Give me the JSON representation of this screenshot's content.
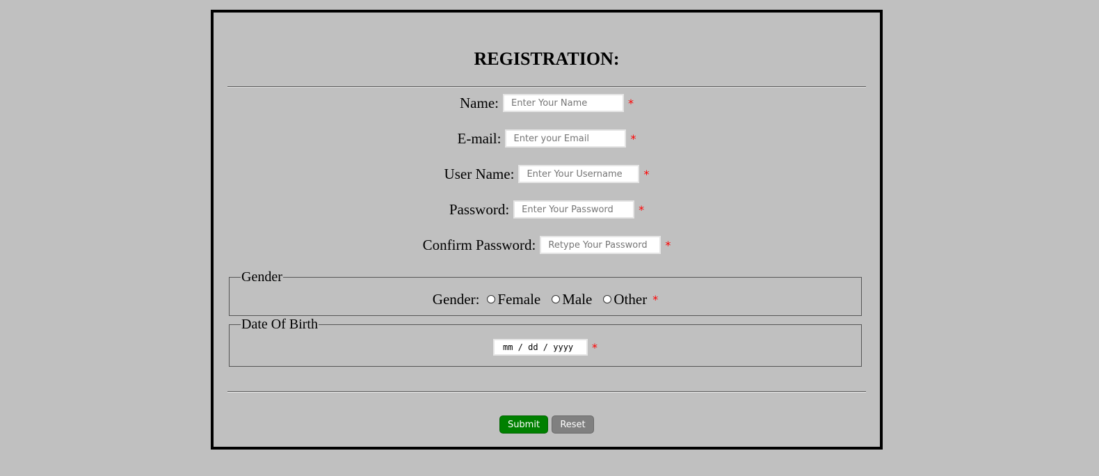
{
  "form": {
    "title": "REGISTRATION:",
    "required_mark": "*",
    "fields": {
      "name": {
        "label": "Name:",
        "placeholder": "Enter Your Name"
      },
      "email": {
        "label": "E-mail:",
        "placeholder": "Enter your Email"
      },
      "username": {
        "label": "User Name:",
        "placeholder": "Enter Your Username"
      },
      "password": {
        "label": "Password:",
        "placeholder": "Enter Your Password"
      },
      "confirm_password": {
        "label": "Confirm Password:",
        "placeholder": "Retype Your Password"
      }
    },
    "gender": {
      "legend": "Gender",
      "label": "Gender:",
      "options": [
        "Female",
        "Male",
        "Other"
      ]
    },
    "dob": {
      "legend": "Date Of Birth",
      "placeholder": "mm / dd / yyyy"
    },
    "buttons": {
      "submit": "Submit",
      "reset": "Reset"
    }
  },
  "colors": {
    "background": "#c0c0c0",
    "required": "#ff0000",
    "submit": "#008000",
    "reset": "#808080"
  }
}
